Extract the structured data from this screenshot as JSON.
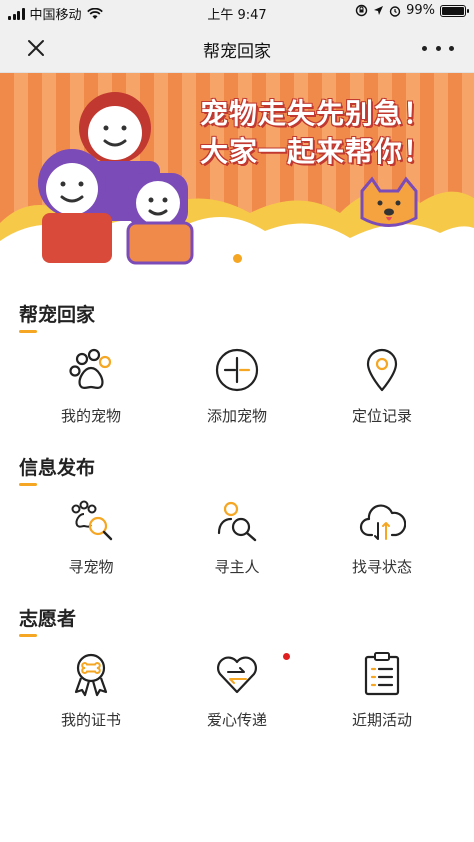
{
  "status_bar": {
    "carrier": "中国移动",
    "time": "上午 9:47",
    "battery": "99%",
    "battery_level": 0.99
  },
  "nav": {
    "title": "帮宠回家",
    "close_icon": "close-icon",
    "more_icon": "more-icon"
  },
  "banner": {
    "line1": "宠物走失先别急！",
    "line2": "大家一起来帮你！"
  },
  "colors": {
    "accent": "#f5a623",
    "banner_orange": "#f08a4b",
    "badge_red": "#e02020"
  },
  "sections": [
    {
      "title": "帮宠回家",
      "items": [
        {
          "label": "我的宠物",
          "icon": "paw-icon"
        },
        {
          "label": "添加宠物",
          "icon": "add-pet-icon"
        },
        {
          "label": "定位记录",
          "icon": "location-pin-icon"
        }
      ]
    },
    {
      "title": "信息发布",
      "items": [
        {
          "label": "寻宠物",
          "icon": "search-pet-icon"
        },
        {
          "label": "寻主人",
          "icon": "search-owner-icon"
        },
        {
          "label": "找寻状态",
          "icon": "cloud-sync-icon"
        }
      ]
    },
    {
      "title": "志愿者",
      "items": [
        {
          "label": "我的证书",
          "icon": "certificate-icon"
        },
        {
          "label": "爱心传递",
          "icon": "heart-transfer-icon",
          "has_badge": true
        },
        {
          "label": "近期活动",
          "icon": "clipboard-list-icon"
        }
      ]
    }
  ]
}
